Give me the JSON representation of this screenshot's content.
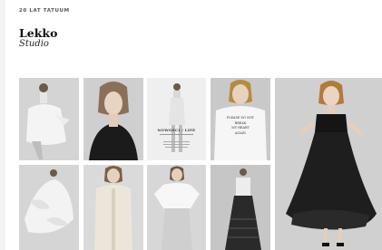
{
  "header": {
    "eyebrow": "20 LAT TATUUM",
    "title": "Lekko",
    "subtitle": "Studio"
  },
  "tiles": [
    {
      "name": "photo-white-dress-sitting"
    },
    {
      "name": "photo-portrait-bob"
    },
    {
      "name": "photo-magazine-page",
      "caption": "NOWOŚCI / LIFE"
    },
    {
      "name": "photo-white-tee-print",
      "shirt_lines": [
        "PLEASE DO NOT",
        "BREAK",
        "MY HEART",
        "AGAIN"
      ]
    },
    {
      "name": "photo-black-gown-large"
    },
    {
      "name": "photo-white-ruffle-dress"
    },
    {
      "name": "photo-linen-suit"
    },
    {
      "name": "photo-white-shirt-skirt"
    },
    {
      "name": "photo-black-sheer-skirt"
    }
  ]
}
